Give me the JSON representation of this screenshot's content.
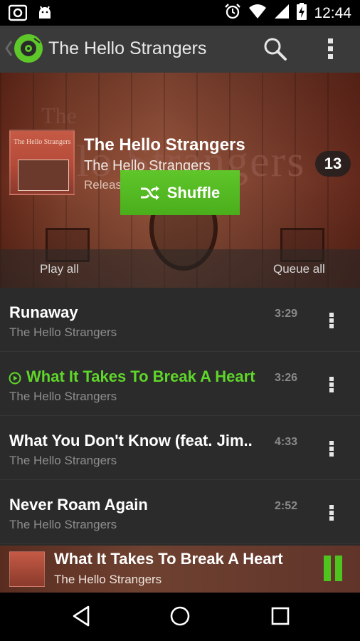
{
  "status_bar": {
    "time": "12:44",
    "icons": [
      "camera-icon",
      "android-icon",
      "alarm-icon",
      "wifi-icon",
      "signal-icon",
      "battery-charging-icon"
    ]
  },
  "action_bar": {
    "title": "The Hello Strangers",
    "icons": [
      "back-chevron-icon",
      "app-logo-icon",
      "search-icon",
      "overflow-menu-icon"
    ]
  },
  "album": {
    "title": "The Hello Strangers",
    "artist": "The Hello Strangers",
    "released": "Released 2014",
    "track_count": "13",
    "art_text": "The Hello Strangers",
    "play_all_label": "Play all",
    "shuffle_label": "Shuffle",
    "queue_all_label": "Queue all"
  },
  "tracks": [
    {
      "title": "Runaway",
      "artist": "The Hello Strangers",
      "duration": "3:29",
      "playing": false
    },
    {
      "title": "What It Takes To Break A Heart",
      "artist": "The Hello Strangers",
      "duration": "3:26",
      "playing": true
    },
    {
      "title": "What You Don't Know (feat. Jim..",
      "artist": "The Hello Strangers",
      "duration": "4:33",
      "playing": false
    },
    {
      "title": "Never Roam Again",
      "artist": "The Hello Strangers",
      "duration": "2:52",
      "playing": false
    }
  ],
  "now_playing": {
    "title": "What It Takes To Break A Heart",
    "artist": "The Hello Strangers",
    "state": "playing"
  },
  "colors": {
    "accent_green": "#4ec51e",
    "playing_text": "#5fd62a",
    "list_bg": "#2b2b2b",
    "action_bar_bg": "#3a3a3a"
  },
  "nav_bar": {
    "icons": [
      "back-triangle-icon",
      "home-circle-icon",
      "recents-square-icon"
    ]
  }
}
